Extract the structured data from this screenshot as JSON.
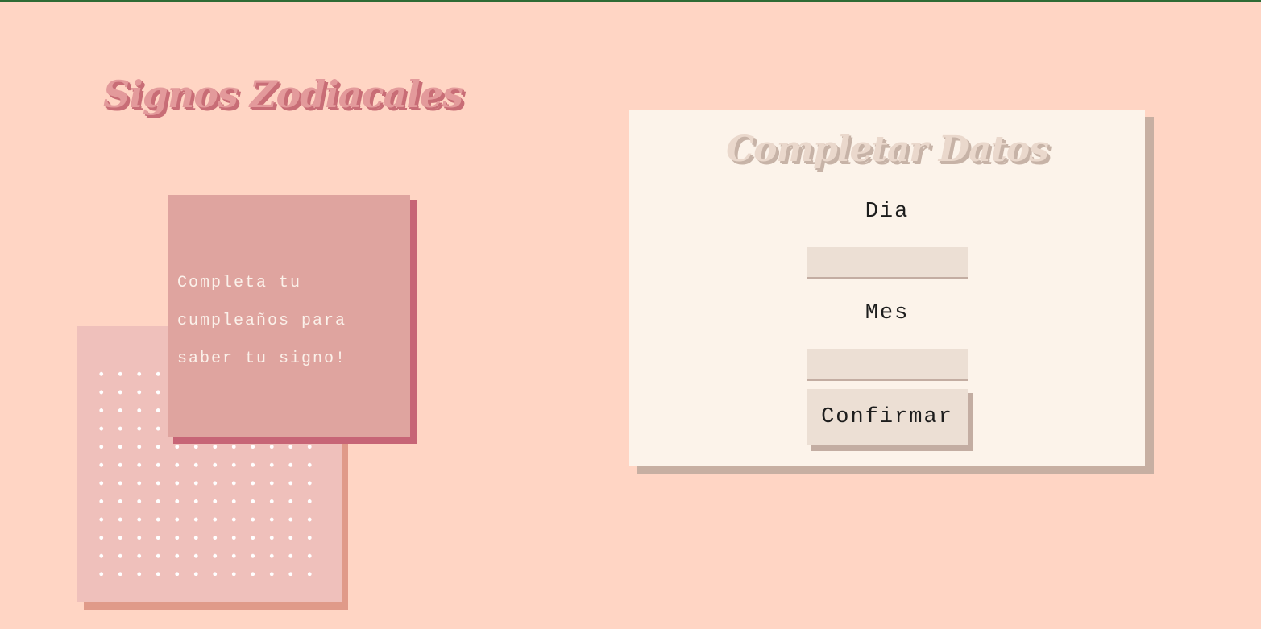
{
  "page": {
    "title": "Signos Zodiacales"
  },
  "intro_card": {
    "message": "Completa tu cumpleaños para saber tu signo!"
  },
  "form": {
    "title": "Completar Datos",
    "day_label": "Dia",
    "day_value": "",
    "month_label": "Mes",
    "month_value": "",
    "confirm_label": "Confirmar"
  },
  "colors": {
    "background": "#ffd5c4",
    "title_pink": "#e39a9b",
    "front_card": "#dfa49f",
    "front_card_shadow": "#c76576",
    "back_card": "#efc0bb",
    "form_panel": "#fcf3ea",
    "input_bg": "#ecdfd4"
  }
}
